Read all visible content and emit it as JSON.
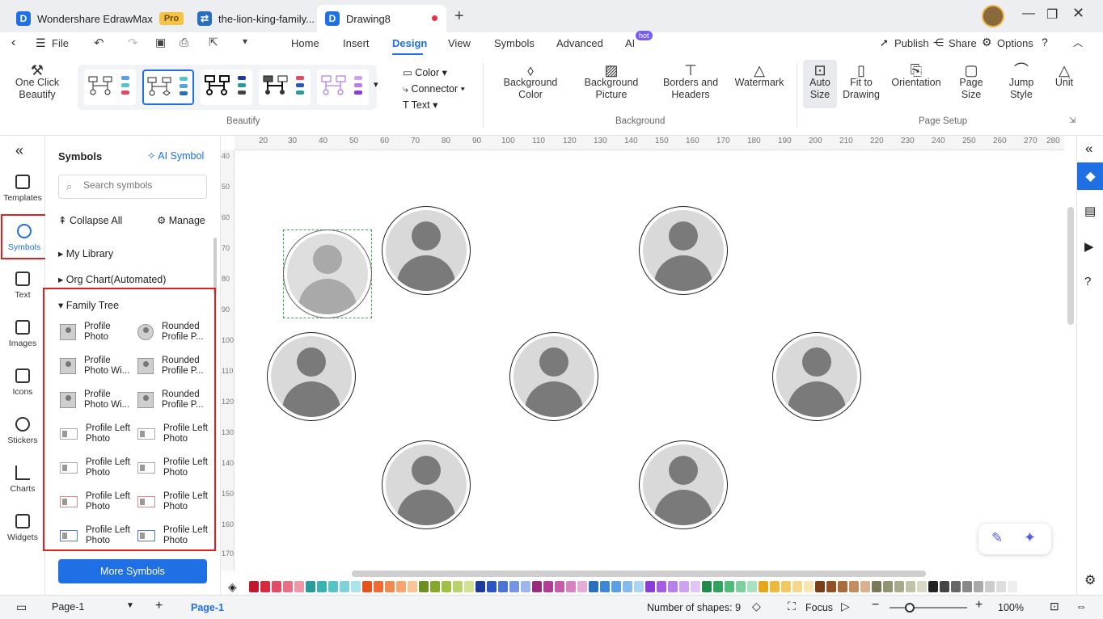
{
  "titlebar": {
    "tabs": [
      {
        "icon": "D",
        "label": "Wondershare EdrawMax",
        "badge": "Pro"
      },
      {
        "icon": "⇄",
        "label": "the-lion-king-family..."
      },
      {
        "icon": "D",
        "label": "Drawing8"
      }
    ],
    "new_tab": "+"
  },
  "menubar": {
    "file": "File",
    "tabs": [
      "Home",
      "Insert",
      "Design",
      "View",
      "Symbols",
      "Advanced",
      "AI"
    ],
    "ai_badge": "hot",
    "active_tab": "Design",
    "publish": "Publish",
    "share": "Share",
    "options": "Options"
  },
  "ribbon": {
    "one_click": "One Click",
    "beautify_label": "Beautify",
    "group_beautify": "Beautify",
    "color": "Color",
    "connector": "Connector",
    "text": "Text",
    "bg_color_1": "Background",
    "bg_color_2": "Color",
    "bg_picture_1": "Background",
    "bg_picture_2": "Picture",
    "borders_1": "Borders and",
    "borders_2": "Headers",
    "watermark": "Watermark",
    "group_background": "Background",
    "auto_size_1": "Auto",
    "auto_size_2": "Size",
    "fit_1": "Fit to",
    "fit_2": "Drawing",
    "orientation": "Orientation",
    "page_size_1": "Page",
    "page_size_2": "Size",
    "jump_1": "Jump",
    "jump_2": "Style",
    "unit": "Unit",
    "group_page_setup": "Page Setup"
  },
  "leftnav": {
    "items": [
      "Templates",
      "Symbols",
      "Text",
      "Images",
      "Icons",
      "Stickers",
      "Charts",
      "Widgets"
    ],
    "active": "Symbols"
  },
  "panel": {
    "title": "Symbols",
    "ai_symbol": "AI Symbol",
    "search_placeholder": "Search symbols",
    "collapse_all": "Collapse All",
    "manage": "Manage",
    "sections": [
      "My Library",
      "Org Chart(Automated)",
      "Family Tree"
    ],
    "symbols": [
      {
        "l1": "Profile",
        "l2": "Photo"
      },
      {
        "l1": "Rounded",
        "l2": "Profile P..."
      },
      {
        "l1": "Profile",
        "l2": "Photo Wi..."
      },
      {
        "l1": "Rounded",
        "l2": "Profile P..."
      },
      {
        "l1": "Profile",
        "l2": "Photo Wi..."
      },
      {
        "l1": "Rounded",
        "l2": "Profile P..."
      },
      {
        "l1": "Profile Left",
        "l2": "Photo"
      },
      {
        "l1": "Profile Left",
        "l2": "Photo"
      },
      {
        "l1": "Profile Left",
        "l2": "Photo"
      },
      {
        "l1": "Profile Left",
        "l2": "Photo"
      },
      {
        "l1": "Profile Left",
        "l2": "Photo"
      },
      {
        "l1": "Profile Left",
        "l2": "Photo"
      },
      {
        "l1": "Profile Left",
        "l2": "Photo"
      },
      {
        "l1": "Profile Left",
        "l2": "Photo"
      }
    ],
    "more_symbols": "More Symbols"
  },
  "rulers": {
    "top": [
      "20",
      "30",
      "40",
      "50",
      "60",
      "70",
      "80",
      "90",
      "100",
      "110",
      "120",
      "130",
      "140",
      "150",
      "160",
      "170",
      "180",
      "190",
      "200",
      "210",
      "220",
      "230",
      "240",
      "250",
      "260",
      "270",
      "280"
    ],
    "left": [
      "40",
      "50",
      "60",
      "70",
      "80",
      "90",
      "100",
      "110",
      "120",
      "130",
      "140",
      "150",
      "160",
      "170"
    ]
  },
  "palette": [
    "#c0182d",
    "#d8293f",
    "#e34a63",
    "#ea6e86",
    "#f196a8",
    "#2a9a9a",
    "#37b3b3",
    "#55c4c7",
    "#7fd3d8",
    "#a9e4e8",
    "#e8521c",
    "#f06a34",
    "#f3894f",
    "#f6a56d",
    "#f9c497",
    "#6e8f20",
    "#85a82c",
    "#9fbf45",
    "#b9d26a",
    "#d0e294",
    "#1d3b9b",
    "#2d56c2",
    "#4a73d7",
    "#7395e3",
    "#9eb6ee",
    "#9a2a7c",
    "#b23c93",
    "#c65aab",
    "#d783c2",
    "#e6acd8",
    "#2a6ec0",
    "#3c87d6",
    "#5aa0e2",
    "#84bbec",
    "#add4f3",
    "#8a3cd6",
    "#a35ce2",
    "#b87eea",
    "#cda2f1",
    "#e0c5f7",
    "#1f8a4a",
    "#2fa35e",
    "#4fbc7a",
    "#7cd09c",
    "#a8e2bf",
    "#e7a61a",
    "#eeb83c",
    "#f2c862",
    "#f6d88c",
    "#f9e6b3",
    "#7a3e17",
    "#925024",
    "#ab6a3a",
    "#c48c5e",
    "#dcb08c",
    "#7a7a5a",
    "#939372",
    "#aaaa8c",
    "#c2c2a8",
    "#d9d9c6",
    "#222222",
    "#444444",
    "#666666",
    "#888888",
    "#aaaaaa",
    "#cccccc",
    "#dddddd",
    "#eeeeee"
  ],
  "status": {
    "page_select": "Page-1",
    "add": "+",
    "page_tab": "Page-1",
    "shapes": "Number of shapes: 9",
    "focus": "Focus",
    "zoom": "100%"
  }
}
